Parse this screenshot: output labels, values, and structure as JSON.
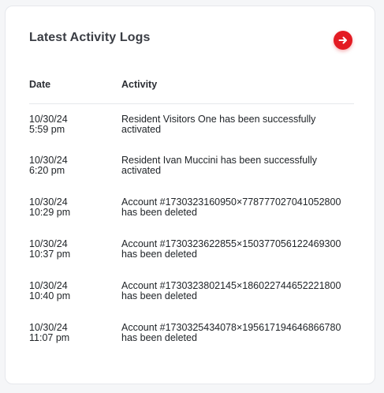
{
  "card": {
    "title": "Latest Activity Logs",
    "action_icon": "arrow-right-circle-icon",
    "accent_color": "#e31b23"
  },
  "table": {
    "headers": {
      "date": "Date",
      "activity": "Activity"
    },
    "rows": [
      {
        "date": "10/30/24\n5:59 pm",
        "activity": "Resident  Visitors  One has been successfully activated"
      },
      {
        "date": "10/30/24\n6:20 pm",
        "activity": "Resident  Ivan  Muccini has been successfully activated"
      },
      {
        "date": "10/30/24\n10:29 pm",
        "activity": "Account #1730323160950×778777027041052800 has been deleted"
      },
      {
        "date": "10/30/24\n10:37 pm",
        "activity": "Account #1730323622855×150377056122469300 has been deleted"
      },
      {
        "date": "10/30/24\n10:40 pm",
        "activity": "Account #1730323802145×186022744652221800 has been deleted"
      },
      {
        "date": "10/30/24\n11:07 pm",
        "activity": "Account #1730325434078×195617194646866780 has been deleted"
      }
    ]
  }
}
